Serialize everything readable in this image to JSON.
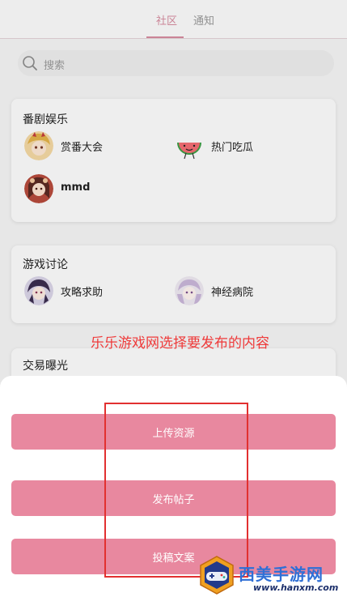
{
  "tabs": {
    "community": "社区",
    "notifications": "通知"
  },
  "search": {
    "placeholder": "搜索"
  },
  "sections": [
    {
      "title": "番剧娱乐",
      "forums": [
        {
          "name": "赏番大会"
        },
        {
          "name": "热门吃瓜"
        },
        {
          "name": "mmd"
        }
      ]
    },
    {
      "title": "游戏讨论",
      "forums": [
        {
          "name": "攻略求助"
        },
        {
          "name": "神经病院"
        }
      ]
    },
    {
      "title": "交易曝光"
    }
  ],
  "annotation": "乐乐游戏网选择要发布的内容",
  "sheet": {
    "buttons": [
      {
        "label": "上传资源"
      },
      {
        "label": "发布帖子"
      },
      {
        "label": "投稿文案"
      }
    ]
  },
  "watermark": {
    "brand": "西美手游网",
    "url": "www.hanxm.com"
  },
  "colors": {
    "accent": "#d58c9f",
    "sheet_button": "#e8889f",
    "annotation": "#ef3a3a"
  }
}
